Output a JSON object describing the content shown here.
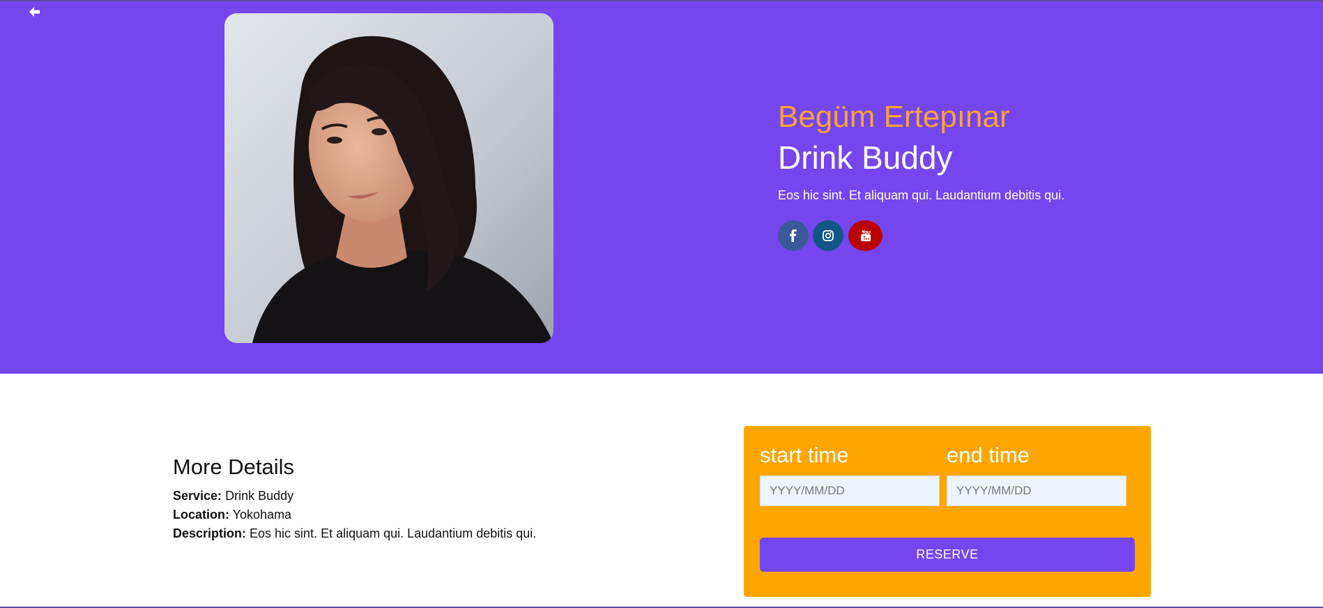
{
  "header": {
    "back_icon": "arrow-left-icon"
  },
  "profile": {
    "name": "Begüm Ertepınar",
    "role": "Drink Buddy",
    "tagline": "Eos hic sint. Et aliquam qui. Laudantium debitis qui.",
    "social": [
      {
        "icon": "facebook-icon",
        "color": "#3b5998"
      },
      {
        "icon": "instagram-icon",
        "color": "#125688"
      },
      {
        "icon": "youtube-icon",
        "color": "#bb0000"
      }
    ]
  },
  "details": {
    "title": "More Details",
    "service_label": "Service:",
    "service_value": "Drink Buddy",
    "location_label": "Location:",
    "location_value": "Yokohama",
    "description_label": "Description:",
    "description_value": "Eos hic sint. Et aliquam qui. Laudantium debitis qui."
  },
  "reservation": {
    "start_label": "start time",
    "end_label": "end time",
    "start_placeholder": "YYYY/MM/DD",
    "end_placeholder": "YYYY/MM/DD",
    "start_value": "",
    "end_value": "",
    "button_label": "RESERVE"
  },
  "colors": {
    "primary": "#7546ee",
    "accent": "#ffa500",
    "name": "#f7a23a"
  }
}
